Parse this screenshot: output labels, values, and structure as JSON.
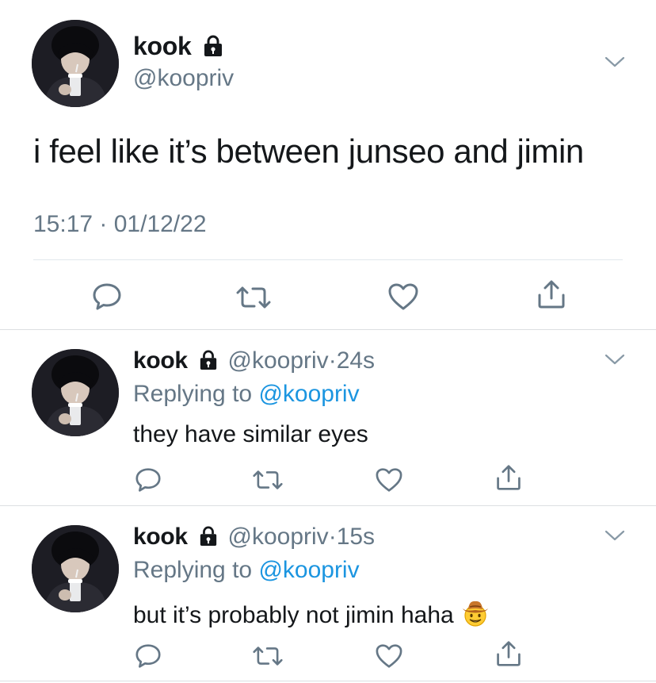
{
  "main_tweet": {
    "name": "kook",
    "handle": "@koopriv",
    "text": "i feel like it’s between junseo and jimin",
    "timestamp": "15:17 · 01/12/22",
    "icons": [
      "lock-icon",
      "chevron-down-icon",
      "reply-icon",
      "retweet-icon",
      "like-icon",
      "share-icon"
    ]
  },
  "replies": [
    {
      "name": "kook",
      "handle": "@koopriv",
      "separator": "·",
      "time": "24s",
      "replying_prefix": "Replying to",
      "replying_to": "@koopriv",
      "text": "they have similar eyes",
      "emoji": ""
    },
    {
      "name": "kook",
      "handle": "@koopriv",
      "separator": "·",
      "time": "15s",
      "replying_prefix": "Replying to",
      "replying_to": "@koopriv",
      "text": "but it’s probably not jimin haha",
      "emoji": "cowboy-emoji"
    }
  ],
  "colors": {
    "text": "#14171a",
    "secondary": "#657786",
    "link": "#1b95e0",
    "divider": "#e1e8ed",
    "icon": "#657786"
  }
}
